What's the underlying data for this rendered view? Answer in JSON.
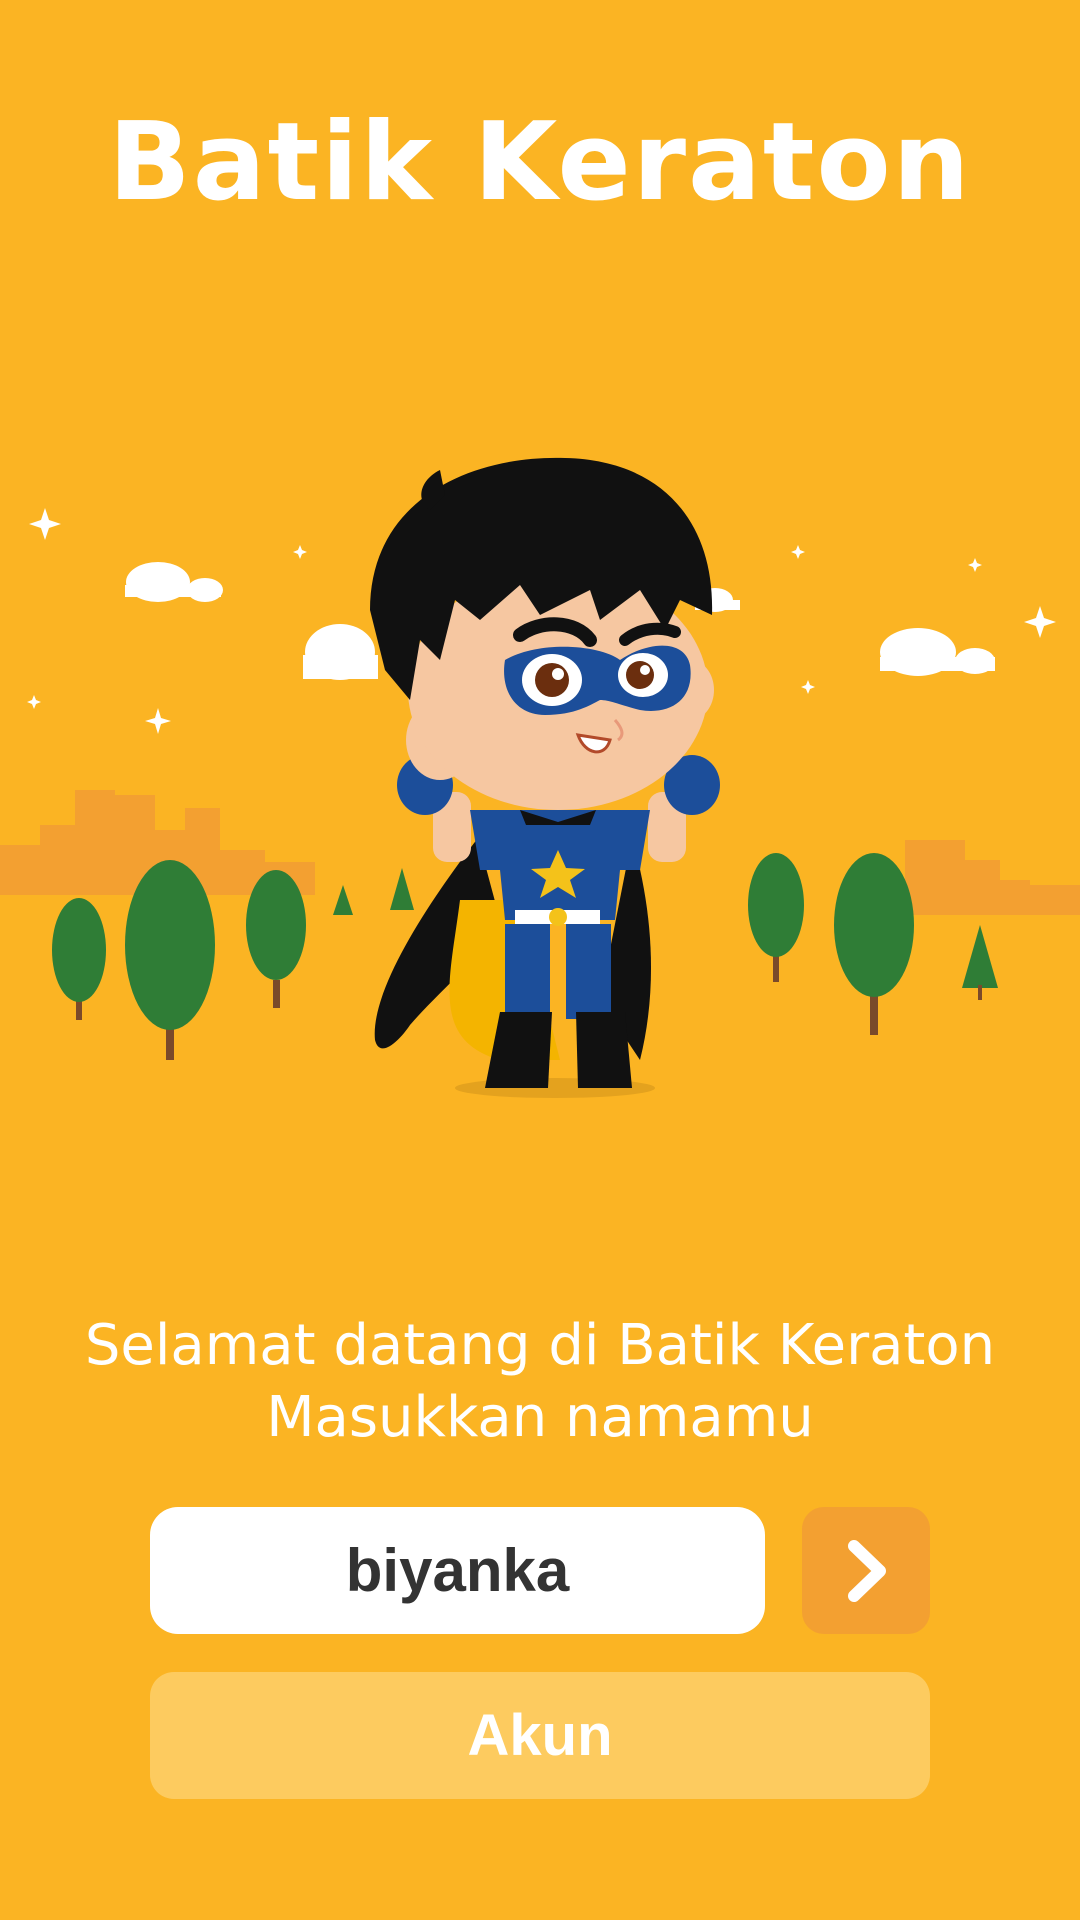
{
  "app": {
    "title": "Batik Keraton"
  },
  "welcome": {
    "line1": "Selamat datang di Batik Keraton",
    "line2": "Masukkan namamu"
  },
  "form": {
    "name_value": "biyanka",
    "next_icon": "chevron-right-icon",
    "account_label": "Akun"
  },
  "colors": {
    "background": "#FBB423",
    "next_button": "#F3A031",
    "account_button": "#FDCB5F",
    "field_text": "#333333"
  }
}
